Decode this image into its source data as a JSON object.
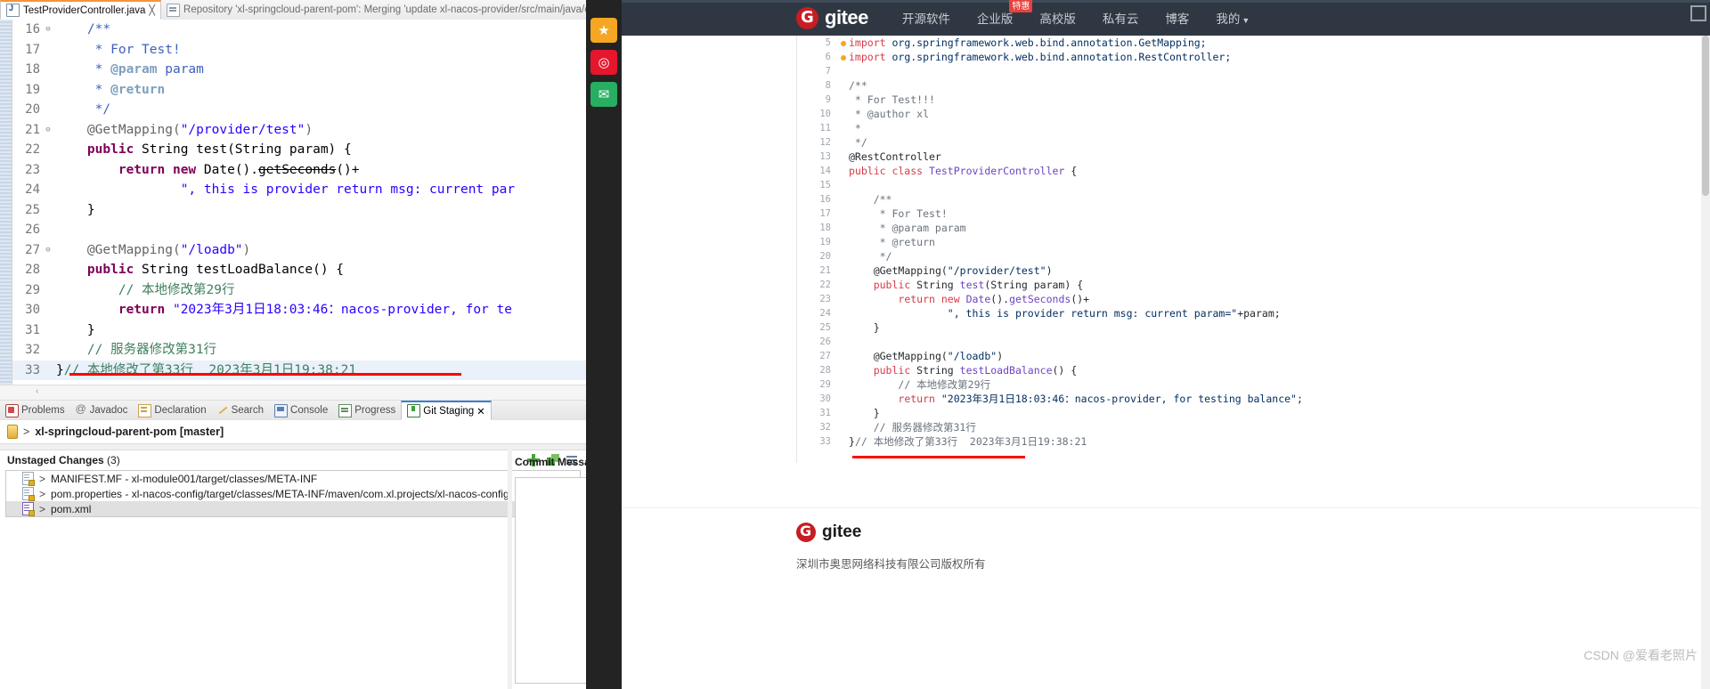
{
  "eclipse": {
    "tabs": [
      {
        "label": "TestProviderController.java",
        "icon": "java-file-icon",
        "active": true,
        "close": "╳"
      },
      {
        "label": "Repository 'xl-springcloud-parent-pom': Merging 'update xl-nacos-provider/src/main/java/com/xl/p",
        "icon": "repository-icon",
        "active": false,
        "close": ""
      }
    ],
    "code_lines": [
      {
        "num": "16",
        "fold": "⊖",
        "html": "<span class='jdoc'>    /**</span>"
      },
      {
        "num": "17",
        "fold": "",
        "html": "<span class='jdoc'>     * For Test!</span>"
      },
      {
        "num": "18",
        "fold": "",
        "html": "<span class='jdoc'>     * </span><span class='jdoc-tag'>@param</span><span class='jdoc'> param</span>"
      },
      {
        "num": "19",
        "fold": "",
        "html": "<span class='jdoc'>     * </span><span class='jdoc-tag'>@return</span>"
      },
      {
        "num": "20",
        "fold": "",
        "html": "<span class='jdoc'>     */</span>"
      },
      {
        "num": "21",
        "fold": "⊖",
        "html": "<span class='anno'>    @GetMapping(</span><span class='str'>\"/provider/test\"</span><span class='anno'>)</span>"
      },
      {
        "num": "22",
        "fold": "",
        "html": "    <span class='kw'>public</span> <span class='plain'>String test(String param) {</span>"
      },
      {
        "num": "23",
        "fold": "",
        "html": "        <span class='kw'>return</span> <span class='kw'>new</span> <span class='plain'>Date().</span><span class='plain strike warnul'>getSeconds</span><span class='plain'>()+</span>"
      },
      {
        "num": "24",
        "fold": "",
        "html": "                <span class='str'>\", this is provider return msg: current par</span>"
      },
      {
        "num": "25",
        "fold": "",
        "html": "    <span class='plain'>}</span>"
      },
      {
        "num": "26",
        "fold": "",
        "html": ""
      },
      {
        "num": "27",
        "fold": "⊖",
        "html": "<span class='anno'>    @GetMapping(</span><span class='str'>\"/loadb\"</span><span class='anno'>)</span>"
      },
      {
        "num": "28",
        "fold": "",
        "html": "    <span class='kw'>public</span> <span class='plain'>String testLoadBalance() {</span>"
      },
      {
        "num": "29",
        "fold": "",
        "html": "        <span class='cmt'>// 本地修改第29行</span>"
      },
      {
        "num": "30",
        "fold": "",
        "html": "        <span class='kw'>return</span> <span class='str'>\"2023年3月1日18:03:46：nacos-provider, for te</span>"
      },
      {
        "num": "31",
        "fold": "",
        "html": "    <span class='plain'>}</span>"
      },
      {
        "num": "32",
        "fold": "",
        "html": "    <span class='cmt'>// 服务器修改第31行</span>"
      },
      {
        "num": "33",
        "fold": "",
        "html": "<span class='plain'>}</span><span class='cmt'>// 本地修改了第33行  2023年3月1日19:38:21</span>",
        "highlight": true
      }
    ],
    "view_tabs": [
      {
        "label": "Problems",
        "icon": "problems-icon",
        "active": false
      },
      {
        "label": "Javadoc",
        "icon": "javadoc-icon",
        "active": false
      },
      {
        "label": "Declaration",
        "icon": "declaration-icon",
        "active": false
      },
      {
        "label": "Search",
        "icon": "search-icon",
        "active": false
      },
      {
        "label": "Console",
        "icon": "console-icon",
        "active": false
      },
      {
        "label": "Progress",
        "icon": "progress-icon",
        "active": false
      },
      {
        "label": "Git Staging",
        "icon": "git-staging-icon",
        "active": true
      }
    ],
    "git_staging": {
      "repo_arrow": ">",
      "repo_label": "xl-springcloud-parent-pom [master]",
      "unstaged_title": "Unstaged Changes",
      "unstaged_count": "(3)",
      "files": [
        {
          "arrow": ">",
          "label": "MANIFEST.MF - xl-module001/target/classes/META-INF",
          "icon": "file-icon",
          "selected": false
        },
        {
          "arrow": ">",
          "label": "pom.properties - xl-nacos-config/target/classes/META-INF/maven/com.xl.projects/xl-nacos-config",
          "icon": "file-icon",
          "selected": false
        },
        {
          "arrow": ">",
          "label": "pom.xml",
          "icon": "xml-file-icon",
          "selected": true
        }
      ],
      "commit_message_label": "Commit Messag"
    }
  },
  "social_sidebar": {
    "buttons": [
      {
        "icon": "star-icon",
        "glyph": "★",
        "color": "#f5a623"
      },
      {
        "icon": "weibo-icon",
        "glyph": "◎",
        "color": "#e6162d"
      },
      {
        "icon": "mail-icon",
        "glyph": "✉",
        "color": "#27ae60"
      }
    ]
  },
  "browser": {
    "header": {
      "brand": "gitee",
      "brand_icon": "gitee-logo-icon",
      "nav": [
        {
          "label": "开源软件",
          "badge": "",
          "caret": false
        },
        {
          "label": "企业版",
          "badge": "特惠",
          "caret": false
        },
        {
          "label": "高校版",
          "badge": "",
          "caret": false
        },
        {
          "label": "私有云",
          "badge": "",
          "caret": false
        },
        {
          "label": "博客",
          "badge": "",
          "caret": false
        },
        {
          "label": "我的",
          "badge": "",
          "caret": true
        }
      ]
    },
    "code_lines": [
      {
        "num": "5",
        "dot": true,
        "html": "<span class='g-kw'>import</span> <span class='g-str'>org.springframework.web.bind.annotation.GetMapping;</span>"
      },
      {
        "num": "6",
        "dot": true,
        "html": "<span class='g-kw'>import</span> <span class='g-str'>org.springframework.web.bind.annotation.RestController;</span>"
      },
      {
        "num": "7",
        "dot": false,
        "html": ""
      },
      {
        "num": "8",
        "dot": false,
        "html": "<span class='g-cmt'>/**</span>"
      },
      {
        "num": "9",
        "dot": false,
        "html": "<span class='g-cmt'> * For Test!!!</span>"
      },
      {
        "num": "10",
        "dot": false,
        "html": "<span class='g-cmt'> * @author xl</span>"
      },
      {
        "num": "11",
        "dot": false,
        "html": "<span class='g-cmt'> *</span>"
      },
      {
        "num": "12",
        "dot": false,
        "html": "<span class='g-cmt'> */</span>"
      },
      {
        "num": "13",
        "dot": false,
        "html": "<span class='g-anno'>@RestController</span>"
      },
      {
        "num": "14",
        "dot": false,
        "html": "<span class='g-kw'>public class</span> <span class='g-fn'>TestProviderController</span> {"
      },
      {
        "num": "15",
        "dot": false,
        "html": ""
      },
      {
        "num": "16",
        "dot": false,
        "html": "    <span class='g-cmt'>/**</span>"
      },
      {
        "num": "17",
        "dot": false,
        "html": "     <span class='g-cmt'>* For Test!</span>"
      },
      {
        "num": "18",
        "dot": false,
        "html": "     <span class='g-cmt'>* @param param</span>"
      },
      {
        "num": "19",
        "dot": false,
        "html": "     <span class='g-cmt'>* @return</span>"
      },
      {
        "num": "20",
        "dot": false,
        "html": "     <span class='g-cmt'>*/</span>"
      },
      {
        "num": "21",
        "dot": false,
        "html": "    <span class='g-anno'>@GetMapping(</span><span class='g-str'>\"/provider/test\"</span><span class='g-anno'>)</span>"
      },
      {
        "num": "22",
        "dot": false,
        "html": "    <span class='g-kw'>public</span> String <span class='g-fn'>test</span>(String param) {"
      },
      {
        "num": "23",
        "dot": false,
        "html": "        <span class='g-kw'>return new</span> <span class='g-fn'>Date</span>().<span class='g-fn'>getSeconds</span>()+"
      },
      {
        "num": "24",
        "dot": false,
        "html": "                <span class='g-str'>\", this is provider return msg: current param=\"</span>+param;"
      },
      {
        "num": "25",
        "dot": false,
        "html": "    }"
      },
      {
        "num": "26",
        "dot": false,
        "html": ""
      },
      {
        "num": "27",
        "dot": false,
        "html": "    <span class='g-anno'>@GetMapping(</span><span class='g-str'>\"/loadb\"</span><span class='g-anno'>)</span>"
      },
      {
        "num": "28",
        "dot": false,
        "html": "    <span class='g-kw'>public</span> String <span class='g-fn'>testLoadBalance</span>() {"
      },
      {
        "num": "29",
        "dot": false,
        "html": "        <span class='g-cmt'>// 本地修改第29行</span>"
      },
      {
        "num": "30",
        "dot": false,
        "html": "        <span class='g-kw'>return</span> <span class='g-str'>\"2023年3月1日18:03:46：nacos-provider, for testing balance\"</span>;"
      },
      {
        "num": "31",
        "dot": false,
        "html": "    }"
      },
      {
        "num": "32",
        "dot": false,
        "html": "    <span class='g-cmt'>// 服务器修改第31行</span>"
      },
      {
        "num": "33",
        "dot": false,
        "html": "}<span class='g-cmt'>// 本地修改了第33行  2023年3月1日19:38:21</span>"
      }
    ],
    "footer": {
      "brand": "gitee",
      "brand_icon": "gitee-logo-icon",
      "copyright": "深圳市奥思网络科技有限公司版权所有"
    },
    "watermark": "CSDN @爱看老照片"
  },
  "colors": {
    "gitee_red": "#c71d23",
    "header_bg": "#2f3842",
    "eclipse_accent": "#f79432",
    "redline": "#ff0000"
  }
}
